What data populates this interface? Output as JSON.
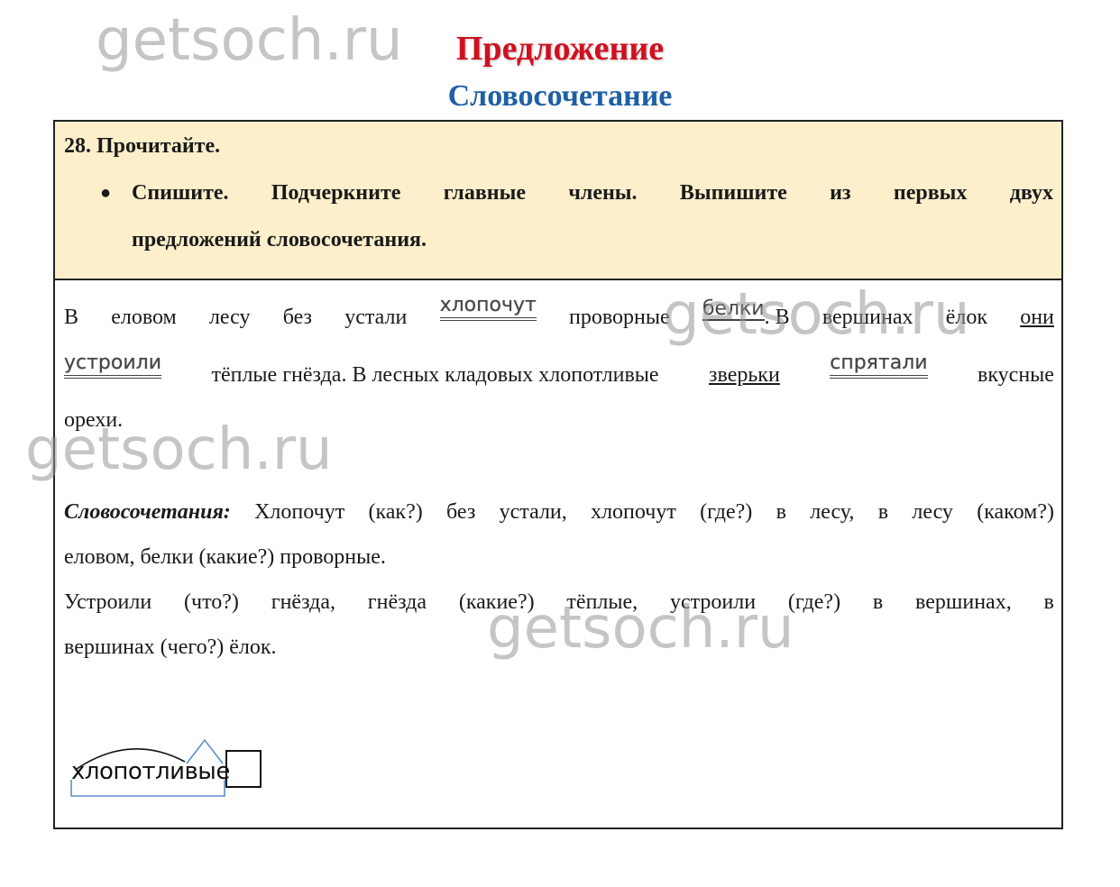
{
  "watermark": "getsoch.ru",
  "header": {
    "title": "Предложение",
    "subtitle": "Словосочетание"
  },
  "task": {
    "number_label": "28. Прочитайте.",
    "bullet": "●",
    "line1_words": [
      "Спишите.",
      "Подчеркните",
      "главные",
      "члены.",
      "Выпишите",
      "из",
      "первых",
      "двух"
    ],
    "line2": "предложений словосочетания."
  },
  "text": {
    "s1_a": [
      "В",
      "еловом",
      "лесу",
      "без",
      "устали"
    ],
    "pred1": "хлопочут",
    "s1_b": "проворные",
    "subj1": "белки",
    "s1_c": ". В",
    "s1_d": [
      "вершинах",
      "ёлок"
    ],
    "subj2": "они",
    "pred2": "устроили",
    "s2_a": "тёплые гнёзда. В лесных кладовых хлопотливые",
    "subj3": "зверьки",
    "pred3": "спрятали",
    "s2_b": "вкусные",
    "s3": "орехи."
  },
  "answer": {
    "label": "Словосочетания:",
    "line1_words": [
      "Хлопочут",
      "(как?)",
      "без",
      "устали,",
      "хлопочут",
      "(где?)",
      "в",
      "лесу,",
      "в",
      "лесу",
      "(каком?)"
    ],
    "line2": "еловом, белки (какие?) проворные.",
    "line3_words": [
      "Устроили",
      "(что?)",
      "гнёзда,",
      "гнёзда",
      "(какие?)",
      "тёплые,",
      "устроили",
      "(где?)",
      "в",
      "вершинах,",
      "в"
    ],
    "line4": "вершинах (чего?) ёлок."
  },
  "morpheme": {
    "word": "хлопотливые"
  },
  "colors": {
    "title_red": "#d01020",
    "title_blue": "#1f5fa5",
    "task_bg": "#fdefcc",
    "morpheme_blue": "#5b8fc7"
  }
}
